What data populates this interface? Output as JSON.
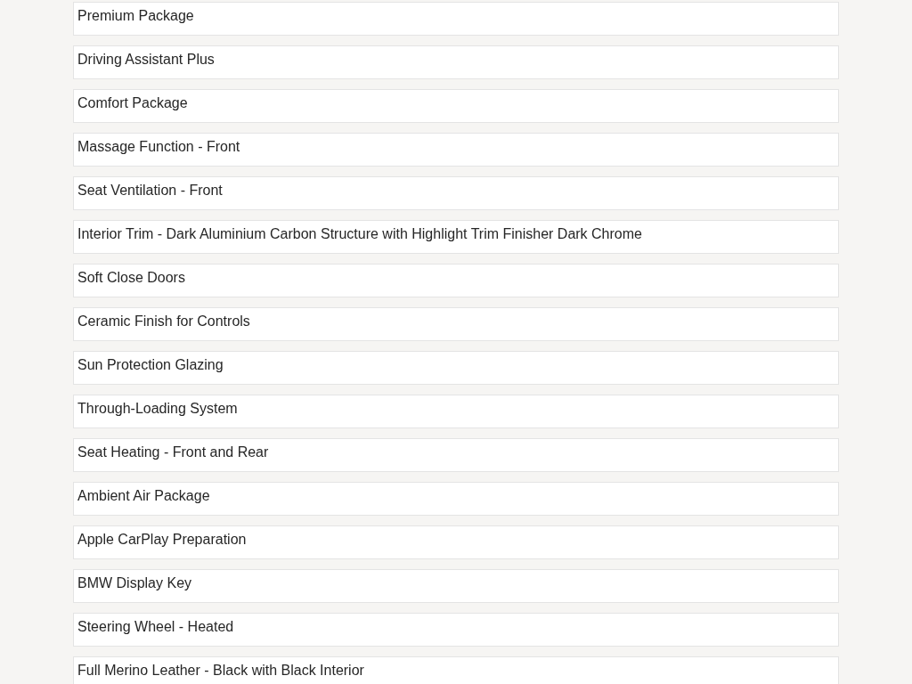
{
  "options": [
    {
      "label": "Premium Package"
    },
    {
      "label": "Driving Assistant Plus"
    },
    {
      "label": "Comfort Package"
    },
    {
      "label": "Massage Function - Front"
    },
    {
      "label": "Seat Ventilation - Front"
    },
    {
      "label": "Interior Trim - Dark Aluminium Carbon Structure with Highlight Trim Finisher Dark Chrome"
    },
    {
      "label": "Soft Close Doors"
    },
    {
      "label": "Ceramic Finish for Controls"
    },
    {
      "label": "Sun Protection Glazing"
    },
    {
      "label": "Through-Loading System"
    },
    {
      "label": "Seat Heating - Front and Rear"
    },
    {
      "label": "Ambient Air Package"
    },
    {
      "label": "Apple CarPlay Preparation"
    },
    {
      "label": "BMW Display Key"
    },
    {
      "label": "Steering Wheel - Heated"
    },
    {
      "label": "Full Merino Leather - Black with Black Interior"
    }
  ]
}
